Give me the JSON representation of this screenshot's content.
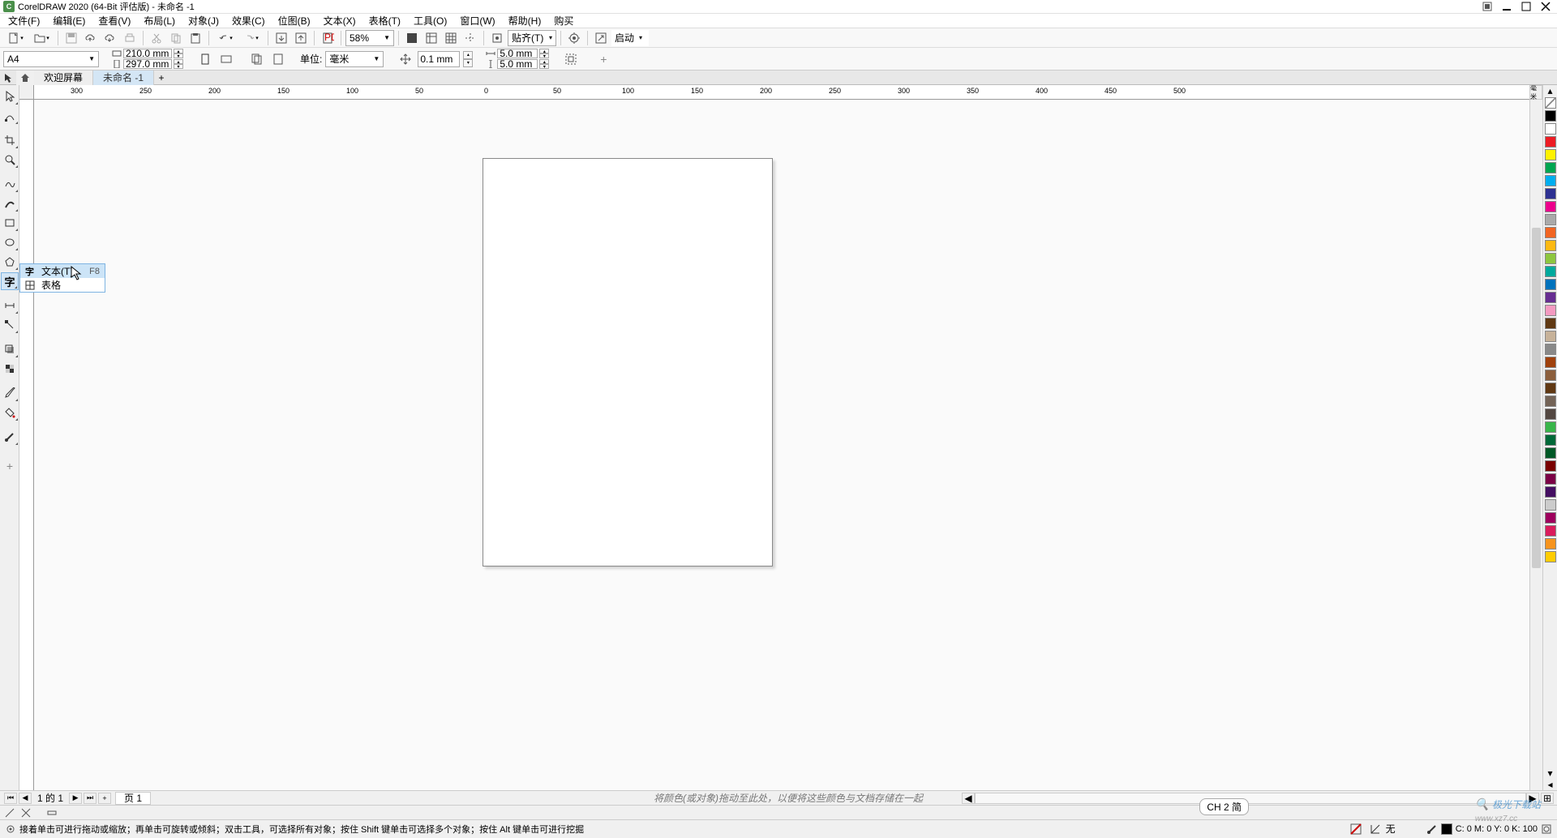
{
  "title": "CorelDRAW 2020 (64-Bit 评估版) - 未命名 -1",
  "menu": {
    "file": "文件(F)",
    "edit": "编辑(E)",
    "view": "查看(V)",
    "layout": "布局(L)",
    "object": "对象(J)",
    "effect": "效果(C)",
    "bitmap": "位图(B)",
    "text": "文本(X)",
    "table": "表格(T)",
    "tool": "工具(O)",
    "window": "窗口(W)",
    "help": "帮助(H)",
    "buy": "购买"
  },
  "toolbar": {
    "zoom": "58%",
    "paste": "贴齐(T)",
    "launch": "启动"
  },
  "propbar": {
    "pagesize": "A4",
    "width": "210.0 mm",
    "height": "297.0 mm",
    "unit_label": "单位:",
    "unit": "毫米",
    "nudge": "0.1 mm",
    "dup_x": "5.0 mm",
    "dup_y": "5.0 mm"
  },
  "tabs": {
    "welcome": "欢迎屏幕",
    "doc": "未命名 -1"
  },
  "flyout": {
    "text_label": "文本(T)",
    "text_shortcut": "F8",
    "table_label": "表格"
  },
  "ruler_ticks": [
    "300",
    "250",
    "200",
    "150",
    "100",
    "50",
    "0",
    "50",
    "100",
    "150",
    "200",
    "250",
    "300",
    "350",
    "400",
    "450",
    "500"
  ],
  "pagenav": {
    "page_of": "1 的 1",
    "page_label": "页 1",
    "hint": "将颜色(或对象)拖动至此处，以便将这些颜色与文档存储在一起"
  },
  "status": {
    "text": "接着单击可进行拖动或缩放；再单击可旋转或倾斜；双击工具，可选择所有对象；按住 Shift 键单击可选择多个对象；按住 Alt 键单击可进行挖掘",
    "none": "无",
    "cmyk": "C: 0 M: 0 Y: 0 K: 100"
  },
  "lang": "CH 2 简",
  "watermark": "极光下载站",
  "watermark_url": "www.xz7.cc",
  "palette": [
    "nocolor",
    "#000000",
    "#ffffff",
    "#ed1c24",
    "#fff200",
    "#00a651",
    "#00aeef",
    "#2e3192",
    "#ec008c",
    "#aaaaaa",
    "#f26522",
    "#fdb913",
    "#8dc63f",
    "#00a99d",
    "#0072bc",
    "#662d91",
    "#f49ac1",
    "#603913",
    "#c7b299",
    "#898989",
    "#a0410d",
    "#8b5e3c",
    "#603813",
    "#736357",
    "#534741",
    "#39b54a",
    "#006838",
    "#005826",
    "#790000",
    "#7b0046",
    "#440e62",
    "#cccccc",
    "#9e005d",
    "#da1c5c",
    "#f7941e",
    "#ffcc00"
  ]
}
